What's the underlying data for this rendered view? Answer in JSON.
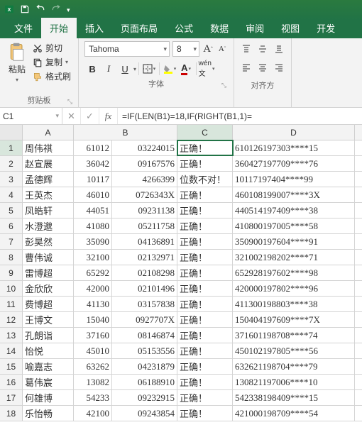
{
  "titlebar": {
    "qat_icons": [
      "save",
      "undo",
      "redo"
    ]
  },
  "tabs": [
    {
      "label": "文件",
      "active": false
    },
    {
      "label": "开始",
      "active": true
    },
    {
      "label": "插入",
      "active": false
    },
    {
      "label": "页面布局",
      "active": false
    },
    {
      "label": "公式",
      "active": false
    },
    {
      "label": "数据",
      "active": false
    },
    {
      "label": "审阅",
      "active": false
    },
    {
      "label": "视图",
      "active": false
    },
    {
      "label": "开发",
      "active": false
    }
  ],
  "ribbon": {
    "clipboard": {
      "paste": "粘贴",
      "cut": "剪切",
      "copy": "复制",
      "format_painter": "格式刷",
      "group": "剪贴板"
    },
    "font": {
      "name": "Tahoma",
      "size": "8",
      "group": "字体"
    },
    "align": {
      "group": "对齐方"
    }
  },
  "namebox": "C1",
  "formula": "=IF(LEN(B1)=18,IF(RIGHT(B1,1)=",
  "columns": [
    "A",
    "B",
    "C",
    "D"
  ],
  "widths": {
    "A": 72,
    "B_num": 54,
    "B": 92,
    "C": 78,
    "D": 172
  },
  "rows": [
    {
      "n": 1,
      "A": "周伟祺",
      "Bn": "61012",
      "B": "03224015",
      "C": "正确！",
      "D": "610126197303****15"
    },
    {
      "n": 2,
      "A": "赵宣展",
      "Bn": "36042",
      "B": "09167576",
      "C": "正确！",
      "D": "360427197709****76"
    },
    {
      "n": 3,
      "A": "孟德辉",
      "Bn": "10117",
      "B": "4266399",
      "C": "位数不对！",
      "D": "10117197404****99"
    },
    {
      "n": 4,
      "A": "王英杰",
      "Bn": "46010",
      "B": "0726343X",
      "C": "正确！",
      "D": "460108199007****3X"
    },
    {
      "n": 5,
      "A": "凤皓轩",
      "Bn": "44051",
      "B": "09231138",
      "C": "正确！",
      "D": "440514197409****38"
    },
    {
      "n": 6,
      "A": "水澄邈",
      "Bn": "41080",
      "B": "05211758",
      "C": "正确！",
      "D": "410800197005****58"
    },
    {
      "n": 7,
      "A": "彭昊然",
      "Bn": "35090",
      "B": "04136891",
      "C": "正确！",
      "D": "350900197604****91"
    },
    {
      "n": 8,
      "A": "曹伟诚",
      "Bn": "32100",
      "B": "02132971",
      "C": "正确！",
      "D": "321002198202****71"
    },
    {
      "n": 9,
      "A": "雷博超",
      "Bn": "65292",
      "B": "02108298",
      "C": "正确！",
      "D": "652928197602****98"
    },
    {
      "n": 10,
      "A": "金欣欣",
      "Bn": "42000",
      "B": "02101496",
      "C": "正确！",
      "D": "420000197802****96"
    },
    {
      "n": 11,
      "A": "费博超",
      "Bn": "41130",
      "B": "03157838",
      "C": "正确！",
      "D": "411300198803****38"
    },
    {
      "n": 12,
      "A": "王博文",
      "Bn": "15040",
      "B": "0927707X",
      "C": "正确！",
      "D": "150404197609****7X"
    },
    {
      "n": 13,
      "A": "孔朗诣",
      "Bn": "37160",
      "B": "08146874",
      "C": "正确！",
      "D": "371601198708****74"
    },
    {
      "n": 14,
      "A": "怡悦",
      "Bn": "45010",
      "B": "05153556",
      "C": "正确！",
      "D": "450102197805****56"
    },
    {
      "n": 15,
      "A": "喻嘉志",
      "Bn": "63262",
      "B": "04231879",
      "C": "正确！",
      "D": "632621198704****79"
    },
    {
      "n": 16,
      "A": "葛伟宸",
      "Bn": "13082",
      "B": "06188910",
      "C": "正确！",
      "D": "130821197006****10"
    },
    {
      "n": 17,
      "A": "何雄博",
      "Bn": "54233",
      "B": "09232915",
      "C": "正确！",
      "D": "542338198409****15"
    },
    {
      "n": 18,
      "A": "乐怡畅",
      "Bn": "42100",
      "B": "09243854",
      "C": "正确！",
      "D": "421000198709****54"
    }
  ],
  "chart_data": {
    "type": "table",
    "columns": [
      "A",
      "B_prefix",
      "B",
      "C",
      "D"
    ],
    "rows": "see rows array above"
  }
}
